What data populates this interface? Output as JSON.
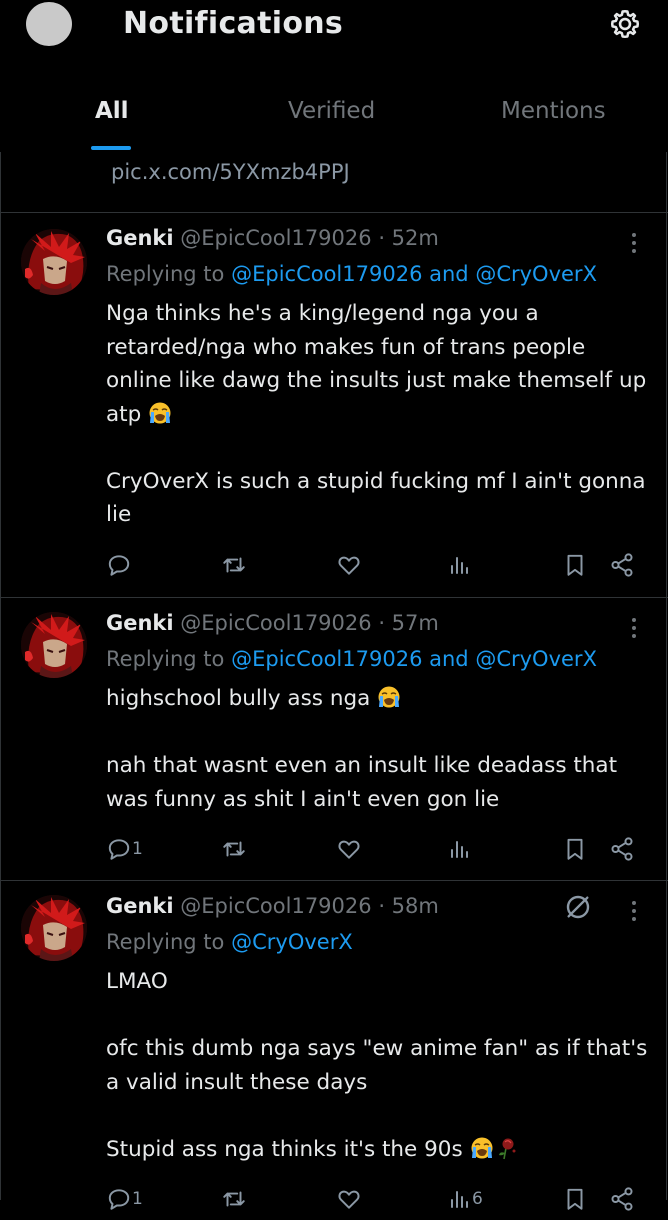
{
  "header": {
    "title": "Notifications",
    "tabs": [
      {
        "label": "All",
        "active": true
      },
      {
        "label": "Verified",
        "active": false
      },
      {
        "label": "Mentions",
        "active": false
      }
    ]
  },
  "previous_post": {
    "link_text": "pic.x.com/5YXmzb4PPJ"
  },
  "posts": [
    {
      "name": "Genki",
      "handle": "@EpicCool179026",
      "time": "· 52m",
      "replying_prefix": "Replying to",
      "replying_to_1": "@EpicCool179026",
      "replying_and": "and",
      "replying_to_2": "@CryOverX",
      "text_1": "Nga thinks he's a king/legend nga you a retarded/nga who makes fun of trans people online like dawg the insults just make themself up atp",
      "emoji_1": "loudly-crying-face",
      "text_2": "CryOverX is such a stupid fucking mf I ain't gonna lie",
      "reply_count": "",
      "view_count": ""
    },
    {
      "name": "Genki",
      "handle": "@EpicCool179026",
      "time": "· 57m",
      "replying_prefix": "Replying to",
      "replying_to_1": "@EpicCool179026",
      "replying_and": "and",
      "replying_to_2": "@CryOverX",
      "text_1": "highschool bully ass nga",
      "emoji_1": "loudly-crying-face",
      "text_2": "nah that wasnt even an insult like deadass that was funny as shit I ain't even gon lie",
      "reply_count": "1",
      "view_count": ""
    },
    {
      "name": "Genki",
      "handle": "@EpicCool179026",
      "time": "· 58m",
      "replying_prefix": "Replying to",
      "replying_to_1": "@CryOverX",
      "text_1": "LMAO",
      "text_2": "ofc this dumb nga says \"ew anime fan\" as if that's a valid insult these days",
      "text_3": "Stupid ass nga thinks it's the 90s",
      "emoji_1": "loudly-crying-face",
      "emoji_2": "wilted-flower",
      "reply_count": "1",
      "view_count": "6"
    }
  ],
  "colors": {
    "background": "#000000",
    "text": "#e7e9ea",
    "secondary_text": "#71767b",
    "accent": "#1d9bf0",
    "divider": "#2f3336"
  },
  "icons": [
    "gear-icon",
    "more-icon",
    "mute-icon",
    "reply-icon",
    "repost-icon",
    "like-icon",
    "views-icon",
    "bookmark-icon",
    "share-icon"
  ]
}
